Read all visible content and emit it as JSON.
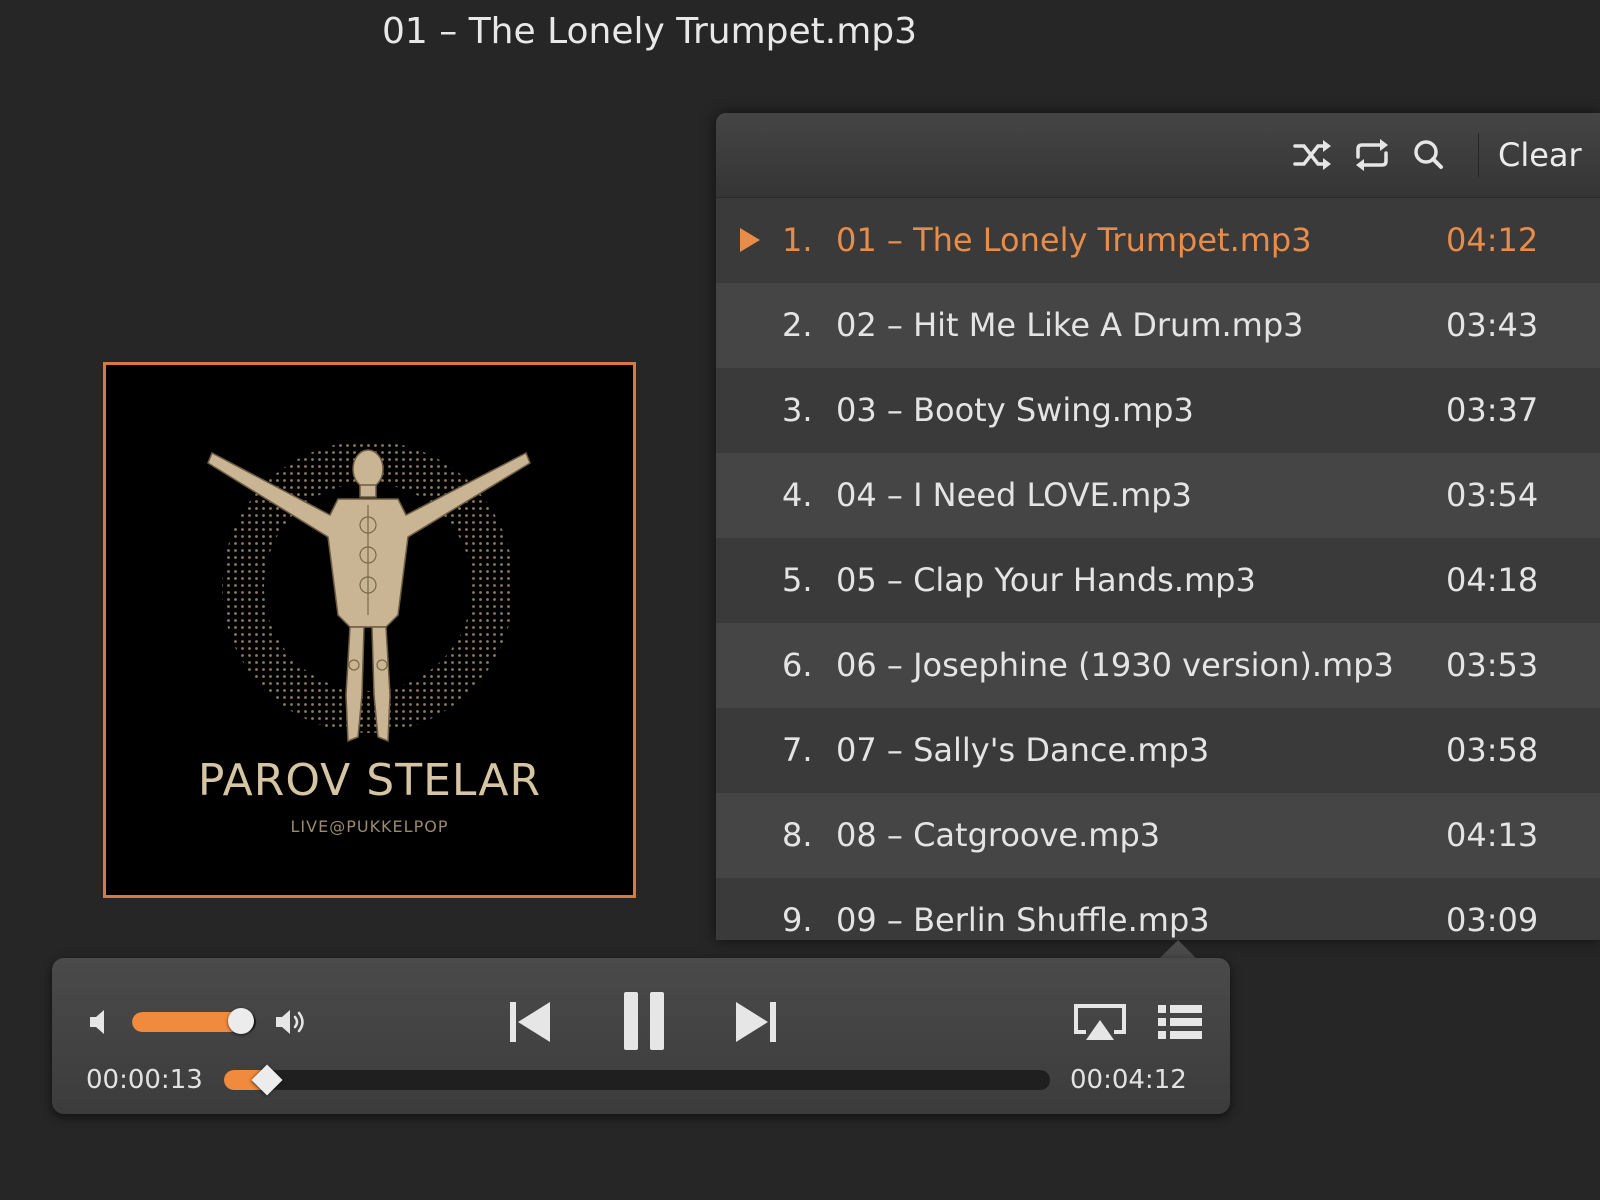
{
  "window": {
    "title": "01 – The Lonely Trumpet.mp3"
  },
  "album_art": {
    "artist": "PAROV STELAR",
    "subtitle": "LIVE@PUKKELPOP"
  },
  "colors": {
    "accent": "#e88c4a",
    "background": "#262626",
    "panel": "#3b3b3b"
  },
  "playlist": {
    "toolbar": {
      "shuffle_icon": "shuffle-icon",
      "repeat_icon": "repeat-icon",
      "search_icon": "search-icon",
      "clear_label": "Clear"
    },
    "tracks": [
      {
        "num": "1.",
        "name": "01 – The Lonely Trumpet.mp3",
        "duration": "04:12"
      },
      {
        "num": "2.",
        "name": "02 – Hit Me Like A Drum.mp3",
        "duration": "03:43"
      },
      {
        "num": "3.",
        "name": "03 – Booty Swing.mp3",
        "duration": "03:37"
      },
      {
        "num": "4.",
        "name": "04 – I Need LOVE.mp3",
        "duration": "03:54"
      },
      {
        "num": "5.",
        "name": "05 – Clap Your Hands.mp3",
        "duration": "04:18"
      },
      {
        "num": "6.",
        "name": "06 – Josephine (1930 version).mp3",
        "duration": "03:53"
      },
      {
        "num": "7.",
        "name": "07 – Sally's Dance.mp3",
        "duration": "03:58"
      },
      {
        "num": "8.",
        "name": "08 – Catgroove.mp3",
        "duration": "04:13"
      },
      {
        "num": "9.",
        "name": "09 – Berlin Shuffle.mp3",
        "duration": "03:09"
      }
    ]
  },
  "player": {
    "elapsed": "00:00:13",
    "total": "00:04:12",
    "volume_fraction": 0.88,
    "progress_fraction": 0.052
  }
}
